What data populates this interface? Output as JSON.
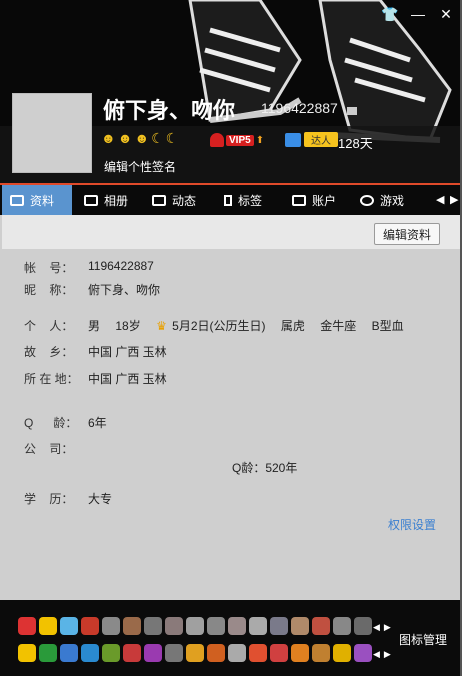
{
  "window": {
    "skin_icon": "shirt-icon",
    "minimize": "—",
    "close": "✕"
  },
  "profile": {
    "nickname": "俯下身、吻你",
    "qq_number": "1196422887",
    "vip_label": "VIP5",
    "daren_label": "达人",
    "days": "128天",
    "signature": "编辑个性签名"
  },
  "tabs": [
    {
      "label": "资料"
    },
    {
      "label": "相册"
    },
    {
      "label": "动态"
    },
    {
      "label": "标签"
    },
    {
      "label": "账户"
    },
    {
      "label": "游戏"
    }
  ],
  "toolbar": {
    "edit_label": "编辑资料"
  },
  "info": {
    "account_key": "帐    号：",
    "account_val": "1196422887",
    "nick_key": "昵    称：",
    "nick_val": "俯下身、吻你",
    "person_key": "个    人：",
    "person_gender": "男",
    "person_age": "18岁",
    "person_birthday": "5月2日(公历生日)",
    "person_zodiac": "属虎",
    "person_star": "金牛座",
    "person_blood": "B型血",
    "hometown_key": "故    乡：",
    "hometown_val": "中国 广西 玉林",
    "location_key": "所 在 地：",
    "location_val": "中国 广西 玉林",
    "qage_key": "Q      龄：",
    "qage_val": "6年",
    "company_key": "公    司：",
    "qage_center": "Q龄：520年",
    "edu_key": "学    历：",
    "edu_val": "大专",
    "permission": "权限设置"
  },
  "bottom": {
    "manager_label": "图标管理"
  }
}
